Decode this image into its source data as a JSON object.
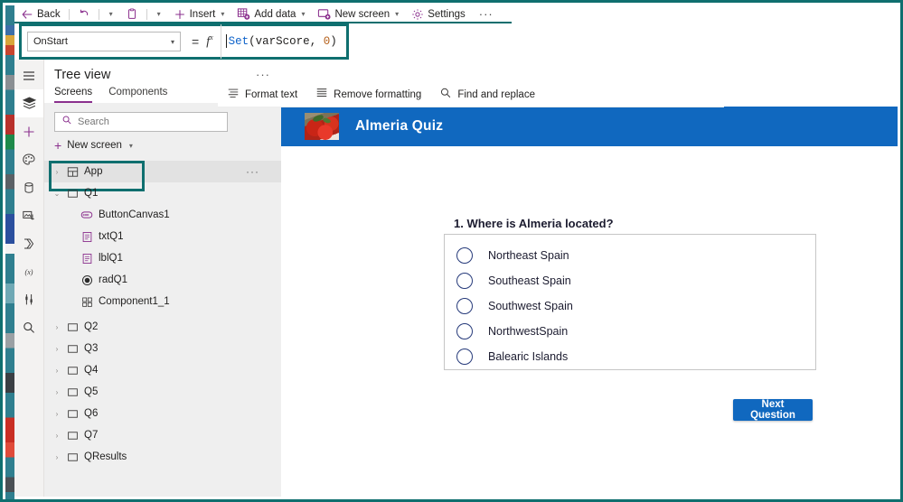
{
  "command_bar": {
    "items": [
      {
        "label": "Back",
        "icon": "back-arrow-icon",
        "has_chevron": false
      },
      {
        "label": "",
        "icon": "undo-icon",
        "has_chevron": false
      },
      {
        "label": "",
        "icon": "redo-chevron-icon",
        "has_chevron": true
      },
      {
        "label": "",
        "icon": "copy-icon",
        "has_chevron": false
      },
      {
        "label": "",
        "icon": "paste-chevron-icon",
        "has_chevron": true
      },
      {
        "label": "Insert",
        "icon": "plus-icon",
        "has_chevron": true
      },
      {
        "label": "Add data",
        "icon": "add-data-icon",
        "has_chevron": true
      },
      {
        "label": "New screen",
        "icon": "new-screen-icon",
        "has_chevron": true
      },
      {
        "label": "Settings",
        "icon": "gear-icon",
        "has_chevron": false
      }
    ],
    "overflow": "···"
  },
  "formula_bar": {
    "property": "OnStart",
    "equals": "=",
    "fx": "fx",
    "formula_tokens": [
      {
        "text": "Set",
        "type": "function"
      },
      {
        "text": "(",
        "type": "punct"
      },
      {
        "text": "varScore",
        "type": "identifier"
      },
      {
        "text": ", ",
        "type": "punct"
      },
      {
        "text": "0",
        "type": "number"
      },
      {
        "text": ")",
        "type": "punct"
      }
    ],
    "formula_plain": "Set(varScore, 0)"
  },
  "rail": {
    "items": [
      {
        "name": "hamburger-menu-icon",
        "selected": false
      },
      {
        "name": "tree-view-icon",
        "selected": true
      },
      {
        "name": "insert-plus-icon",
        "selected": false
      },
      {
        "name": "theme-palette-icon",
        "selected": false
      },
      {
        "name": "data-sources-icon",
        "selected": false
      },
      {
        "name": "media-icon",
        "selected": false
      },
      {
        "name": "power-automate-icon",
        "selected": false
      },
      {
        "name": "variables-icon",
        "selected": false
      },
      {
        "name": "experimental-icon",
        "selected": false
      },
      {
        "name": "search-icon",
        "selected": false
      }
    ]
  },
  "tree_view": {
    "title": "Tree view",
    "overflow": "···",
    "tabs": [
      {
        "label": "Screens",
        "active": true
      },
      {
        "label": "Components",
        "active": false
      }
    ],
    "search_placeholder": "Search",
    "new_screen_label": "New screen",
    "rows": [
      {
        "label": "App",
        "icon": "app-icon",
        "twist": "›",
        "indent": 0,
        "selected": true,
        "dots": "···"
      },
      {
        "label": "Q1",
        "icon": "screen-icon",
        "twist": "⌄",
        "indent": 0,
        "selected": false,
        "dots": ""
      },
      {
        "label": "ButtonCanvas1",
        "icon": "button-icon",
        "twist": "",
        "indent": 2,
        "selected": false,
        "dots": ""
      },
      {
        "label": "txtQ1",
        "icon": "text-input-icon",
        "twist": "",
        "indent": 2,
        "selected": false,
        "dots": ""
      },
      {
        "label": "lblQ1",
        "icon": "label-icon",
        "twist": "",
        "indent": 2,
        "selected": false,
        "dots": ""
      },
      {
        "label": "radQ1",
        "icon": "radio-icon",
        "twist": "",
        "indent": 2,
        "selected": false,
        "dots": ""
      },
      {
        "label": "Component1_1",
        "icon": "component-icon",
        "twist": "",
        "indent": 2,
        "selected": false,
        "dots": ""
      },
      {
        "label": "Q2",
        "icon": "screen-icon",
        "twist": "›",
        "indent": 0,
        "selected": false,
        "dots": ""
      },
      {
        "label": "Q3",
        "icon": "screen-icon",
        "twist": "›",
        "indent": 0,
        "selected": false,
        "dots": ""
      },
      {
        "label": "Q4",
        "icon": "screen-icon",
        "twist": "›",
        "indent": 0,
        "selected": false,
        "dots": ""
      },
      {
        "label": "Q5",
        "icon": "screen-icon",
        "twist": "›",
        "indent": 0,
        "selected": false,
        "dots": ""
      },
      {
        "label": "Q6",
        "icon": "screen-icon",
        "twist": "›",
        "indent": 0,
        "selected": false,
        "dots": ""
      },
      {
        "label": "Q7",
        "icon": "screen-icon",
        "twist": "›",
        "indent": 0,
        "selected": false,
        "dots": ""
      },
      {
        "label": "QResults",
        "icon": "screen-icon",
        "twist": "›",
        "indent": 0,
        "selected": false,
        "dots": ""
      }
    ]
  },
  "format_toolbar": {
    "items": [
      {
        "label": "Format text",
        "icon": "format-text-icon"
      },
      {
        "label": "Remove formatting",
        "icon": "remove-formatting-icon"
      },
      {
        "label": "Find and replace",
        "icon": "find-replace-icon"
      }
    ]
  },
  "canvas": {
    "app_title": "Almeria Quiz",
    "logo_alt": "red-peppers-photo",
    "question": "1. Where is Almeria located?",
    "options": [
      "Northeast Spain",
      "Southeast Spain",
      "Southwest Spain",
      "NorthwestSpain",
      "Balearic Islands"
    ],
    "selected_option": null,
    "next_button": "Next Question"
  },
  "colors": {
    "accent_teal": "#0f6f6f",
    "brand_purple": "#8a2f8d",
    "app_blue": "#1068bf",
    "panel_gray": "#efefef",
    "formula_function": "#0d62c9",
    "formula_number": "#b5601a"
  }
}
